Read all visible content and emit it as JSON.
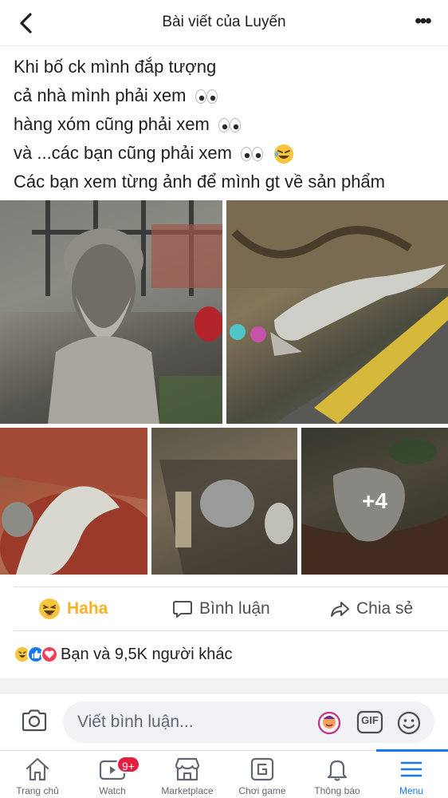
{
  "header": {
    "title": "Bài viết của Luyến",
    "back_icon": "chevron-left-icon",
    "more_label": "•••"
  },
  "post": {
    "lines": [
      "Khi bố ck mình đắp tượng",
      "cả nhà mình phải xem",
      "hàng xóm cũng phải xem",
      "và ...các bạn cũng phải xem",
      "Các bạn xem từng ảnh để mình gt về sản phẩm"
    ],
    "photo_overflow": "+4"
  },
  "actions": {
    "haha": "Haha",
    "comment": "Bình luận",
    "share": "Chia sẻ"
  },
  "reactions": {
    "summary": "Bạn và 9,5K người khác",
    "icons": [
      "haha-icon",
      "like-icon",
      "love-icon"
    ]
  },
  "comment_bar": {
    "placeholder": "Viết bình luận...",
    "gif_label": "GIF"
  },
  "tabbar": {
    "tabs": [
      {
        "label": "Trang chủ",
        "icon": "home-icon"
      },
      {
        "label": "Watch",
        "icon": "watch-icon",
        "badge": "9+"
      },
      {
        "label": "Marketplace",
        "icon": "marketplace-icon"
      },
      {
        "label": "Chơi game",
        "icon": "game-icon"
      },
      {
        "label": "Thông báo",
        "icon": "bell-icon"
      },
      {
        "label": "Menu",
        "icon": "menu-icon",
        "active": true
      }
    ]
  },
  "colors": {
    "accent": "#1877f2",
    "haha": "#f7b125",
    "badge": "#e41e3f"
  }
}
